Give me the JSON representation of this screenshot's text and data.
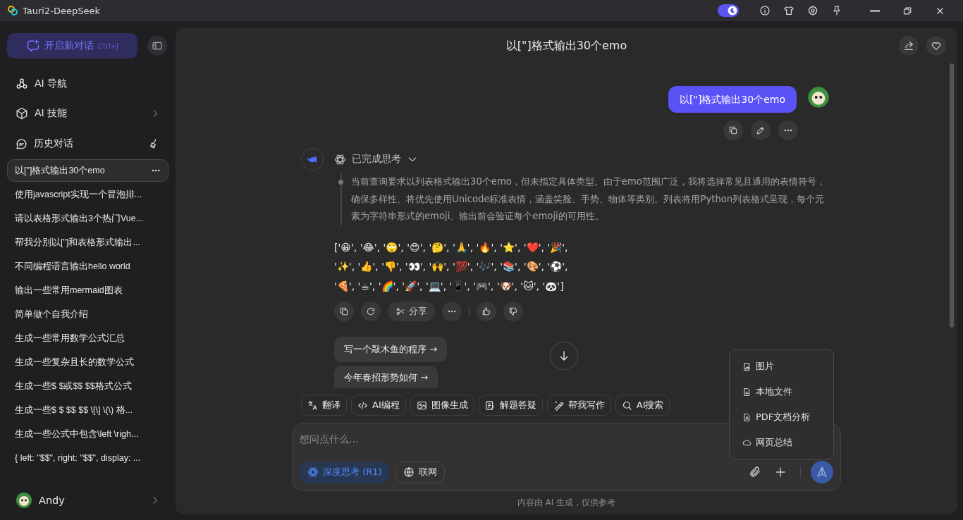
{
  "window": {
    "title": "Tauri2-DeepSeek",
    "theme_switch": {
      "on": true
    }
  },
  "sidebar": {
    "new_chat": {
      "label": "开启新对话",
      "shortcut": "Ctrl+J"
    },
    "nav": [
      {
        "label": "AI 导航",
        "kind": "link"
      },
      {
        "label": "AI 技能",
        "kind": "expand"
      }
    ],
    "history_title": "历史对话",
    "history": [
      {
        "title": "以[\"]格式输出30个emo",
        "selected": true
      },
      {
        "title": "使用javascript实现一个冒泡排...",
        "selected": false
      },
      {
        "title": "请以表格形式输出3个热门Vue...",
        "selected": false
      },
      {
        "title": "帮我分别以[\"]和表格形式输出...",
        "selected": false
      },
      {
        "title": "不同编程语言输出hello world",
        "selected": false
      },
      {
        "title": "输出一些常用mermaid图表",
        "selected": false
      },
      {
        "title": "简单做个自我介绍",
        "selected": false
      },
      {
        "title": "生成一些常用数学公式汇总",
        "selected": false
      },
      {
        "title": "生成一些复杂且长的数学公式",
        "selected": false
      },
      {
        "title": "生成一些$ $或$$ $$格式公式",
        "selected": false
      },
      {
        "title": "生成一些$ $ $$ $$ \\[\\] \\(\\) 格...",
        "selected": false
      },
      {
        "title": "生成一些公式中包含\\left \\righ...",
        "selected": false
      },
      {
        "title": "{ left: \"$$\", right: \"$$\", display: ...",
        "selected": false
      }
    ],
    "user": {
      "name": "Andy"
    }
  },
  "chat": {
    "title": "以[\"]格式输出30个emo",
    "user_message": "以[\"]格式输出30个emo",
    "assistant": {
      "thinking_label": "已完成思考",
      "thinking_expanded": true,
      "thinking": "当前查询要求以列表格式输出30个emo，但未指定具体类型。由于emo范围广泛，我将选择常见且通用的表情符号，确保多样性。将优先使用Unicode标准表情，涵盖笑脸、手势、物体等类别。列表将用Python列表格式呈现，每个元素为字符串形式的emoji。输出前会验证每个emoji的可用性。",
      "answer_lines": [
        "['😀', '😂', '🙄', '😍', '🤔', '🙏', '🔥', '⭐', '❤️', '🎉',",
        "'✨', '👍', '👎', '👀', '🙌', '💯', '🎶', '📚', '🎨', '⚽',",
        "'🍕', '☕', '🌈', '🚀', '💻', '📱', '🎮', '🐶', '🐱', '🐼']"
      ],
      "share_label": "分享"
    },
    "suggestions": [
      "写一个敲木鱼的程序 →",
      "今年春招形势如何 →"
    ],
    "tools": [
      "翻译",
      "AI编程",
      "图像生成",
      "解题答疑",
      "帮我写作",
      "AI搜索"
    ],
    "input": {
      "placeholder": "想问点什么...",
      "toggles": [
        {
          "label": "深度思考 (R1)",
          "on": true
        },
        {
          "label": "联网",
          "on": false
        }
      ]
    },
    "upload_menu": [
      "图片",
      "本地文件",
      "PDF文档分析",
      "网页总结"
    ],
    "footer": "内容由 AI 生成，仅供参考"
  }
}
